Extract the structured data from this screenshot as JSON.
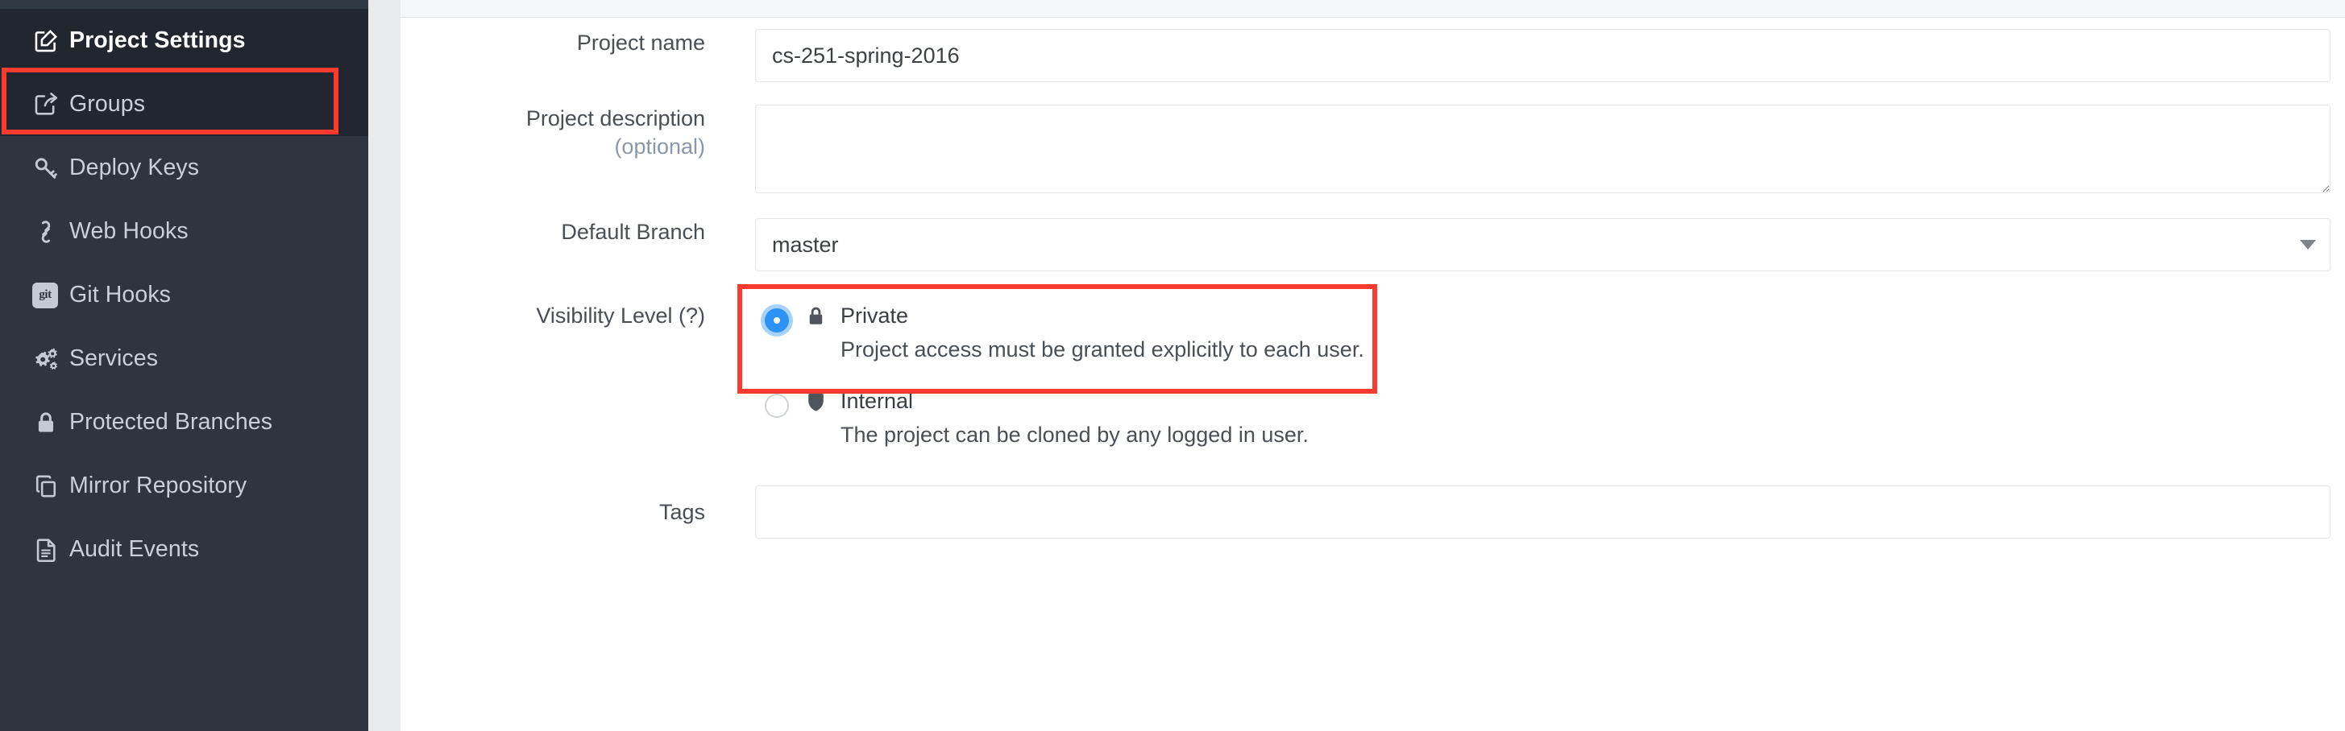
{
  "sidebar": {
    "items": [
      {
        "label": "Project Settings",
        "icon": "edit-square-icon",
        "state": "header"
      },
      {
        "label": "Groups",
        "icon": "share-arrow-icon",
        "state": "active"
      },
      {
        "label": "Deploy Keys",
        "icon": "key-icon",
        "state": "normal"
      },
      {
        "label": "Web Hooks",
        "icon": "link-icon",
        "state": "normal"
      },
      {
        "label": "Git Hooks",
        "icon": "git-badge-icon",
        "state": "normal"
      },
      {
        "label": "Services",
        "icon": "gears-icon",
        "state": "normal"
      },
      {
        "label": "Protected Branches",
        "icon": "lock-icon",
        "state": "normal"
      },
      {
        "label": "Mirror Repository",
        "icon": "copy-icon",
        "state": "normal"
      },
      {
        "label": "Audit Events",
        "icon": "document-icon",
        "state": "normal"
      }
    ]
  },
  "form": {
    "project_name": {
      "label": "Project name",
      "value": "cs-251-spring-2016",
      "placeholder": ""
    },
    "project_description": {
      "label": "Project description",
      "sublabel": "(optional)",
      "value": "",
      "placeholder": ""
    },
    "default_branch": {
      "label": "Default Branch",
      "value": "master",
      "options": [
        "master"
      ]
    },
    "visibility": {
      "label": "Visibility Level (?)",
      "options": [
        {
          "id": "private",
          "title": "Private",
          "description": "Project access must be granted explicitly to each user.",
          "icon": "lock-icon",
          "selected": true
        },
        {
          "id": "internal",
          "title": "Internal",
          "description": "The project can be cloned by any logged in user.",
          "icon": "shield-icon",
          "selected": false
        }
      ]
    },
    "tags": {
      "label": "Tags",
      "value": "",
      "placeholder": ""
    }
  },
  "annotations": {
    "highlight_color": "#fb3b30",
    "targets": [
      "sidebar-item-groups",
      "visibility-option-private"
    ]
  },
  "colors": {
    "sidebar_bg": "#2e353e",
    "sidebar_active_bg": "#22262e",
    "accent_radio": "#2a93f5",
    "gutter": "#e9eaec"
  }
}
